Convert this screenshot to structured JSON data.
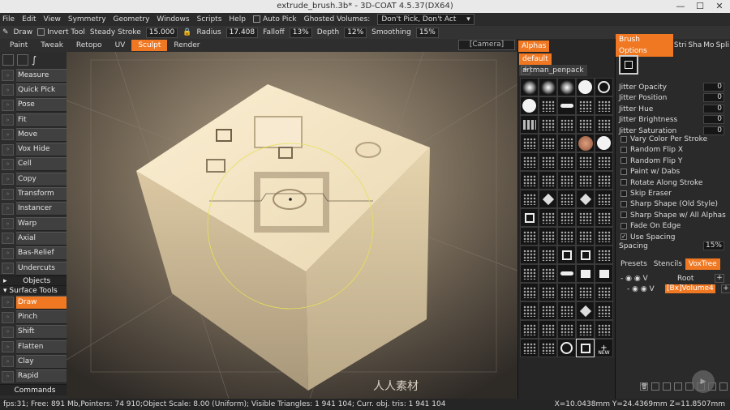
{
  "window": {
    "title": "extrude_brush.3b* - 3D-COAT 4.5.37(DX64)",
    "min": "—",
    "max": "☐",
    "close": "✕"
  },
  "menu": [
    "File",
    "Edit",
    "View",
    "Symmetry",
    "Geometry",
    "Windows",
    "Scripts",
    "Help"
  ],
  "menubar": {
    "autopick_label": "Auto Pick",
    "ghosted_label": "Ghosted Volumes:",
    "ghosted_value": "Don't Pick, Don't Act"
  },
  "tool_options": {
    "draw_label": "Draw",
    "invert_label": "Invert Tool",
    "steady_label": "Steady Stroke",
    "steady_value": "15.000",
    "radius_label": "Radius",
    "radius_value": "17.408",
    "falloff_label": "Falloff",
    "falloff_value": "13%",
    "depth_label": "Depth",
    "depth_value": "12%",
    "smoothing_label": "Smoothing",
    "smoothing_value": "15%"
  },
  "room_tabs": [
    "Paint",
    "Tweak",
    "Retopo",
    "UV",
    "Sculpt",
    "Render"
  ],
  "active_room_tab": "Sculpt",
  "camera_label": "[Camera]",
  "left_tools_top": [
    "Measure",
    "Quick Pick",
    "Pose",
    "Fit",
    "Move",
    "Vox Hide",
    "Cell",
    "Copy",
    "Transform",
    "Instancer",
    "Warp",
    "Axial",
    "Bas-Relief",
    "Undercuts"
  ],
  "section_objects": "Objects",
  "section_surface": "Surface Tools",
  "left_tools_surface": [
    "Draw",
    "Pinch",
    "Shift",
    "Flatten",
    "Clay",
    "Rapid"
  ],
  "active_tool": "Draw",
  "section_commands": "Commands",
  "alphas_panel": {
    "tab": "Alphas",
    "sets": [
      "default",
      "artman_penpack"
    ],
    "new_label": "NEW"
  },
  "brush_options": {
    "tabs": [
      "Brush Options",
      "Stri",
      "Sha",
      "Mo",
      "Spli"
    ],
    "rows": [
      {
        "label": "Jitter Opacity",
        "value": "0"
      },
      {
        "label": "Jitter Position",
        "value": "0"
      },
      {
        "label": "Jitter Hue",
        "value": "0"
      },
      {
        "label": "Jitter Brightness",
        "value": "0"
      },
      {
        "label": "Jitter Saturation",
        "value": "0"
      }
    ],
    "checks": [
      {
        "label": "Vary Color Per Stroke",
        "checked": false
      },
      {
        "label": "Random Flip X",
        "checked": false
      },
      {
        "label": "Random Flip Y",
        "checked": false
      },
      {
        "label": "Paint w/ Dabs",
        "checked": false
      },
      {
        "label": "Rotate Along Stroke",
        "checked": false
      },
      {
        "label": "Skip Eraser",
        "checked": false
      },
      {
        "label": "Sharp Shape (Old Style)",
        "checked": false
      },
      {
        "label": "Sharp Shape w/ All Alphas",
        "checked": false
      },
      {
        "label": "Fade On Edge",
        "checked": false
      },
      {
        "label": "Use Spacing",
        "checked": true
      }
    ],
    "spacing_label": "Spacing",
    "spacing_value": "15%"
  },
  "presets_panel": {
    "tabs": [
      "Presets",
      "Stencils",
      "VoxTree"
    ],
    "root_label": "Root",
    "volume_label": "[Bx]Volume4"
  },
  "status": {
    "left": "fps:31;  Free: 891 Mb,Pointers: 74 910;Object Scale: 8.00 (Uniform); Visible Triangles: 1 941 104; Curr. obj. tris: 1 941 104",
    "coords": "X=10.0438mm  Y=24.4369mm  Z=11.8507mm"
  },
  "watermark": "人人素材",
  "colors": {
    "accent": "#f07822",
    "cube_top": "#f3e4c2",
    "cube_side": "#cfbd98"
  }
}
